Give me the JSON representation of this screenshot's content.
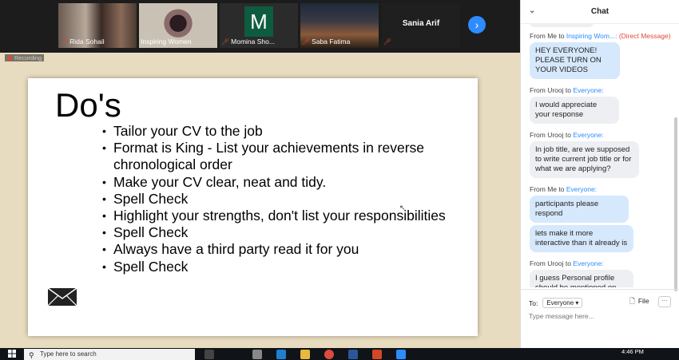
{
  "gallery": {
    "participants": [
      {
        "name": "Rida Sohail",
        "muted": true
      },
      {
        "name": "Inspiring Women",
        "muted": false
      },
      {
        "name": "Momina Sho...",
        "muted": true,
        "initial": "M",
        "initial_color": "#0d5c3f"
      },
      {
        "name": "Saba Fatima",
        "muted": true
      },
      {
        "name": "Sania Arif",
        "muted": true
      }
    ],
    "next_icon": "chevron-right-icon"
  },
  "screen": {
    "recording_label": "Recording",
    "slide": {
      "title": "Do's",
      "bullets": [
        "Tailor your CV to the job",
        "Format is King - List your achievements in reverse chronological order",
        "Make your CV clear, neat and tidy.",
        "Spell Check",
        "Highlight your strengths, don't list your responsibilities",
        "Spell Check",
        "Always have a third party read it for you",
        "Spell Check"
      ],
      "icon": "envelope-icon"
    }
  },
  "chat": {
    "title": "Chat",
    "messages": [
      {
        "from": "From Me to",
        "to": "Inspiring Wom...:",
        "note": "(Direct Message)",
        "texts": [
          "HEY EVERYONE! PLEASE TURN ON YOUR VIDEOS"
        ],
        "mine": true
      },
      {
        "from": "From Urooj to",
        "to": "Everyone:",
        "texts": [
          "I would appreciate your response"
        ],
        "mine": false
      },
      {
        "from": "From Urooj to",
        "to": "Everyone:",
        "texts": [
          "In job title, are we supposed to write current job title or for what we are applying?"
        ],
        "mine": false
      },
      {
        "from": "From Me to",
        "to": "Everyone:",
        "texts": [
          "participants please respond",
          "lets make it more interactive than it already is"
        ],
        "mine": true
      },
      {
        "from": "From Urooj to",
        "to": "Everyone:",
        "texts": [
          "I guess Personal profile should be mentioned on top"
        ],
        "mine": false
      }
    ],
    "footer": {
      "to_label": "To:",
      "to_value": "Everyone",
      "file_label": "File",
      "more_label": "···",
      "input_placeholder": "Type message here..."
    }
  },
  "taskbar": {
    "search_placeholder": "Type here to search",
    "time": "4:46 PM"
  },
  "colors": {
    "accent": "#2d8cff",
    "muted_mic": "#e0483a",
    "my_bubble": "#d6e8fb",
    "other_bubble": "#eeeff2"
  }
}
